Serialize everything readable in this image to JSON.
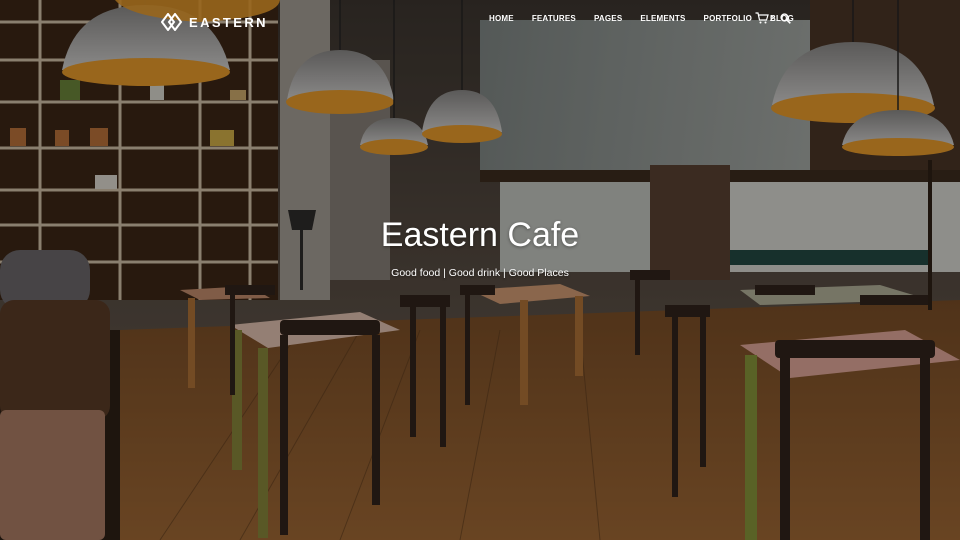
{
  "brand": {
    "name": "EASTERN"
  },
  "nav": {
    "items": [
      {
        "label": "HOME"
      },
      {
        "label": "FEATURES"
      },
      {
        "label": "PAGES"
      },
      {
        "label": "ELEMENTS"
      },
      {
        "label": "PORTFOLIO"
      },
      {
        "label": "BLOG"
      }
    ]
  },
  "cart": {
    "count": "2",
    "icon": "cart-icon"
  },
  "search": {
    "icon": "search-icon"
  },
  "hero": {
    "title": "Eastern Cafe",
    "subtitle": "Good food | Good drink | Good Places"
  },
  "colors": {
    "text": "#ffffff",
    "lamp_glow": "#f0a02a",
    "floor": "#8a5a2e"
  }
}
